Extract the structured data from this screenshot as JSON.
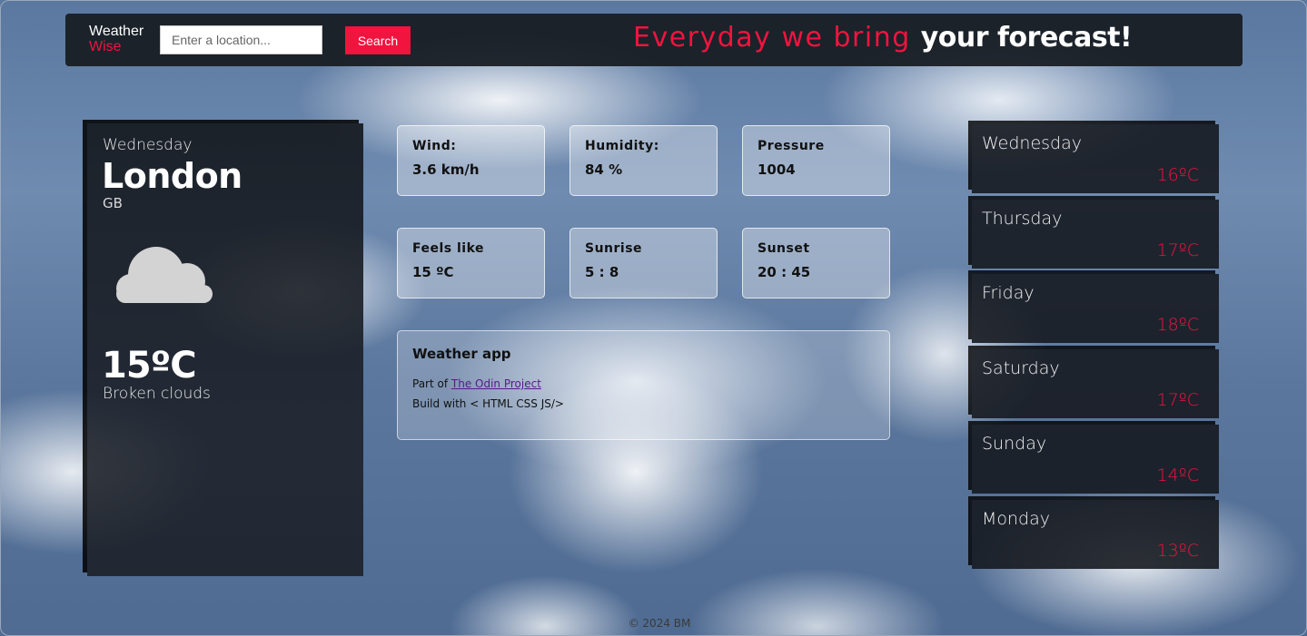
{
  "header": {
    "logo_line1": "Weather",
    "logo_line2": "Wise",
    "search_placeholder": "Enter a location...",
    "search_label": "Search",
    "tagline_red": "Everyday we bring",
    "tagline_white": "your forecast!"
  },
  "current": {
    "day": "Wednesday",
    "city": "London",
    "country": "GB",
    "icon": "cloud-icon",
    "temp": "15ºC",
    "description": "Broken clouds"
  },
  "stats": [
    {
      "label": "Wind:",
      "value": "3.6 km/h"
    },
    {
      "label": "Humidity:",
      "value": "84 %"
    },
    {
      "label": "Pressure",
      "value": "1004"
    },
    {
      "label": "Feels like",
      "value": "15 ºC"
    },
    {
      "label": "Sunrise",
      "value": "5 : 8"
    },
    {
      "label": "Sunset",
      "value": "20 : 45"
    }
  ],
  "about": {
    "title": "Weather app",
    "part_of": "Part of ",
    "link_text": "The Odin Project",
    "build_with": "Build with < HTML CSS JS/>"
  },
  "forecast": [
    {
      "day": "Wednesday",
      "temp": "16ºC"
    },
    {
      "day": "Thursday",
      "temp": "17ºC"
    },
    {
      "day": "Friday",
      "temp": "18ºC"
    },
    {
      "day": "Saturday",
      "temp": "17ºC"
    },
    {
      "day": "Sunday",
      "temp": "14ºC"
    },
    {
      "day": "Monday",
      "temp": "13ºC"
    }
  ],
  "footer": "© 2024 BM",
  "colors": {
    "accent": "#f0143e",
    "panel": "#16191f"
  }
}
